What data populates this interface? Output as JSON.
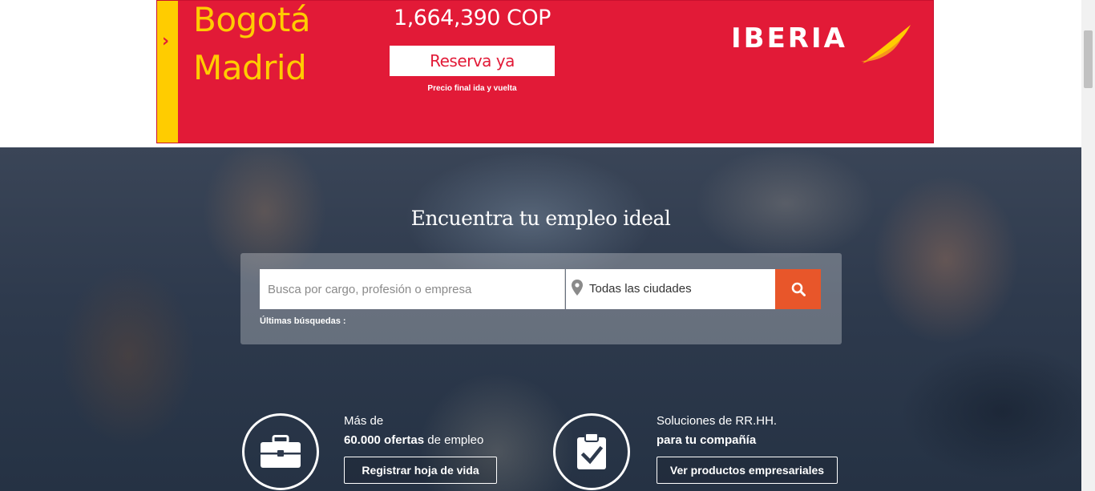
{
  "ad": {
    "arrow": "›",
    "origin": "Bogotá",
    "destination": "Madrid",
    "price": "1,664,390 COP",
    "cta": "Reserva ya",
    "note": "Precio final ida y vuelta",
    "brand": "IBERIA",
    "colors": {
      "background": "#e21a37",
      "accent": "#ffcc00"
    }
  },
  "hero": {
    "title": "Encuentra tu empleo ideal",
    "search": {
      "placeholder": "Busca por cargo, profesión o empresa",
      "value": "",
      "location_icon": "map-pin-icon",
      "location_value": "Todas las ciudades",
      "button_icon": "search-icon",
      "recent_label": "Últimas búsquedas :"
    },
    "features": [
      {
        "icon": "briefcase-icon",
        "line1": "Más de",
        "line2_bold": "60.000 ofertas",
        "line2_rest": " de empleo",
        "button": "Registrar hoja de vida"
      },
      {
        "icon": "clipboard-check-icon",
        "line1": "Soluciones de RR.HH.",
        "line2_bold": "para tu compañía",
        "line2_rest": "",
        "button": "Ver productos empresariales"
      }
    ]
  },
  "colors": {
    "accent": "#e8562a"
  }
}
